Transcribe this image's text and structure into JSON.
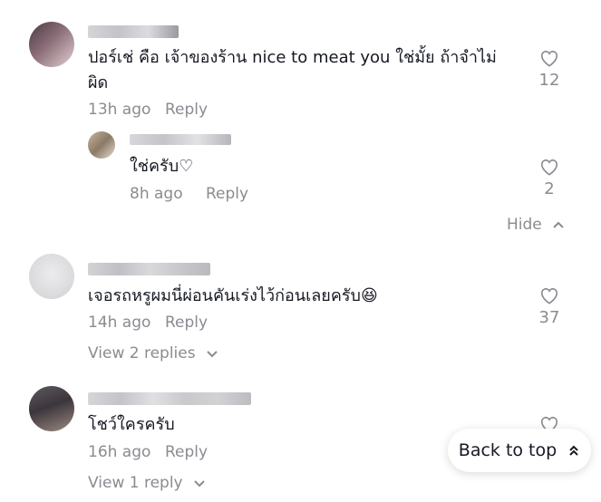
{
  "comments": [
    {
      "text_line1": "ปอร์เช่ คือ เจ้าของร้าน nice to meat you ใช่มั้ย ถ้าจำไม่",
      "text_line2": "ผิด",
      "time": "13h ago",
      "reply_label": "Reply",
      "likes": "12",
      "like_icon": "heart-outline-icon"
    },
    {
      "text": "เจอรถหรูผมนี่ผ่อนคันเร่งไว้ก่อนเลยครับ😆",
      "time": "14h ago",
      "reply_label": "Reply",
      "likes": "37",
      "view_replies": "View 2 replies"
    },
    {
      "text": "โชว์ใครครับ",
      "time": "16h ago",
      "reply_label": "Reply",
      "view_replies": "View 1 reply"
    }
  ],
  "reply": {
    "text": "ใช่ครับ♡",
    "time": "8h ago",
    "reply_label": "Reply",
    "likes": "2"
  },
  "hide_label": "Hide",
  "back_to_top": "Back to top",
  "colors": {
    "muted": "#8a8b91",
    "text": "#161823"
  }
}
